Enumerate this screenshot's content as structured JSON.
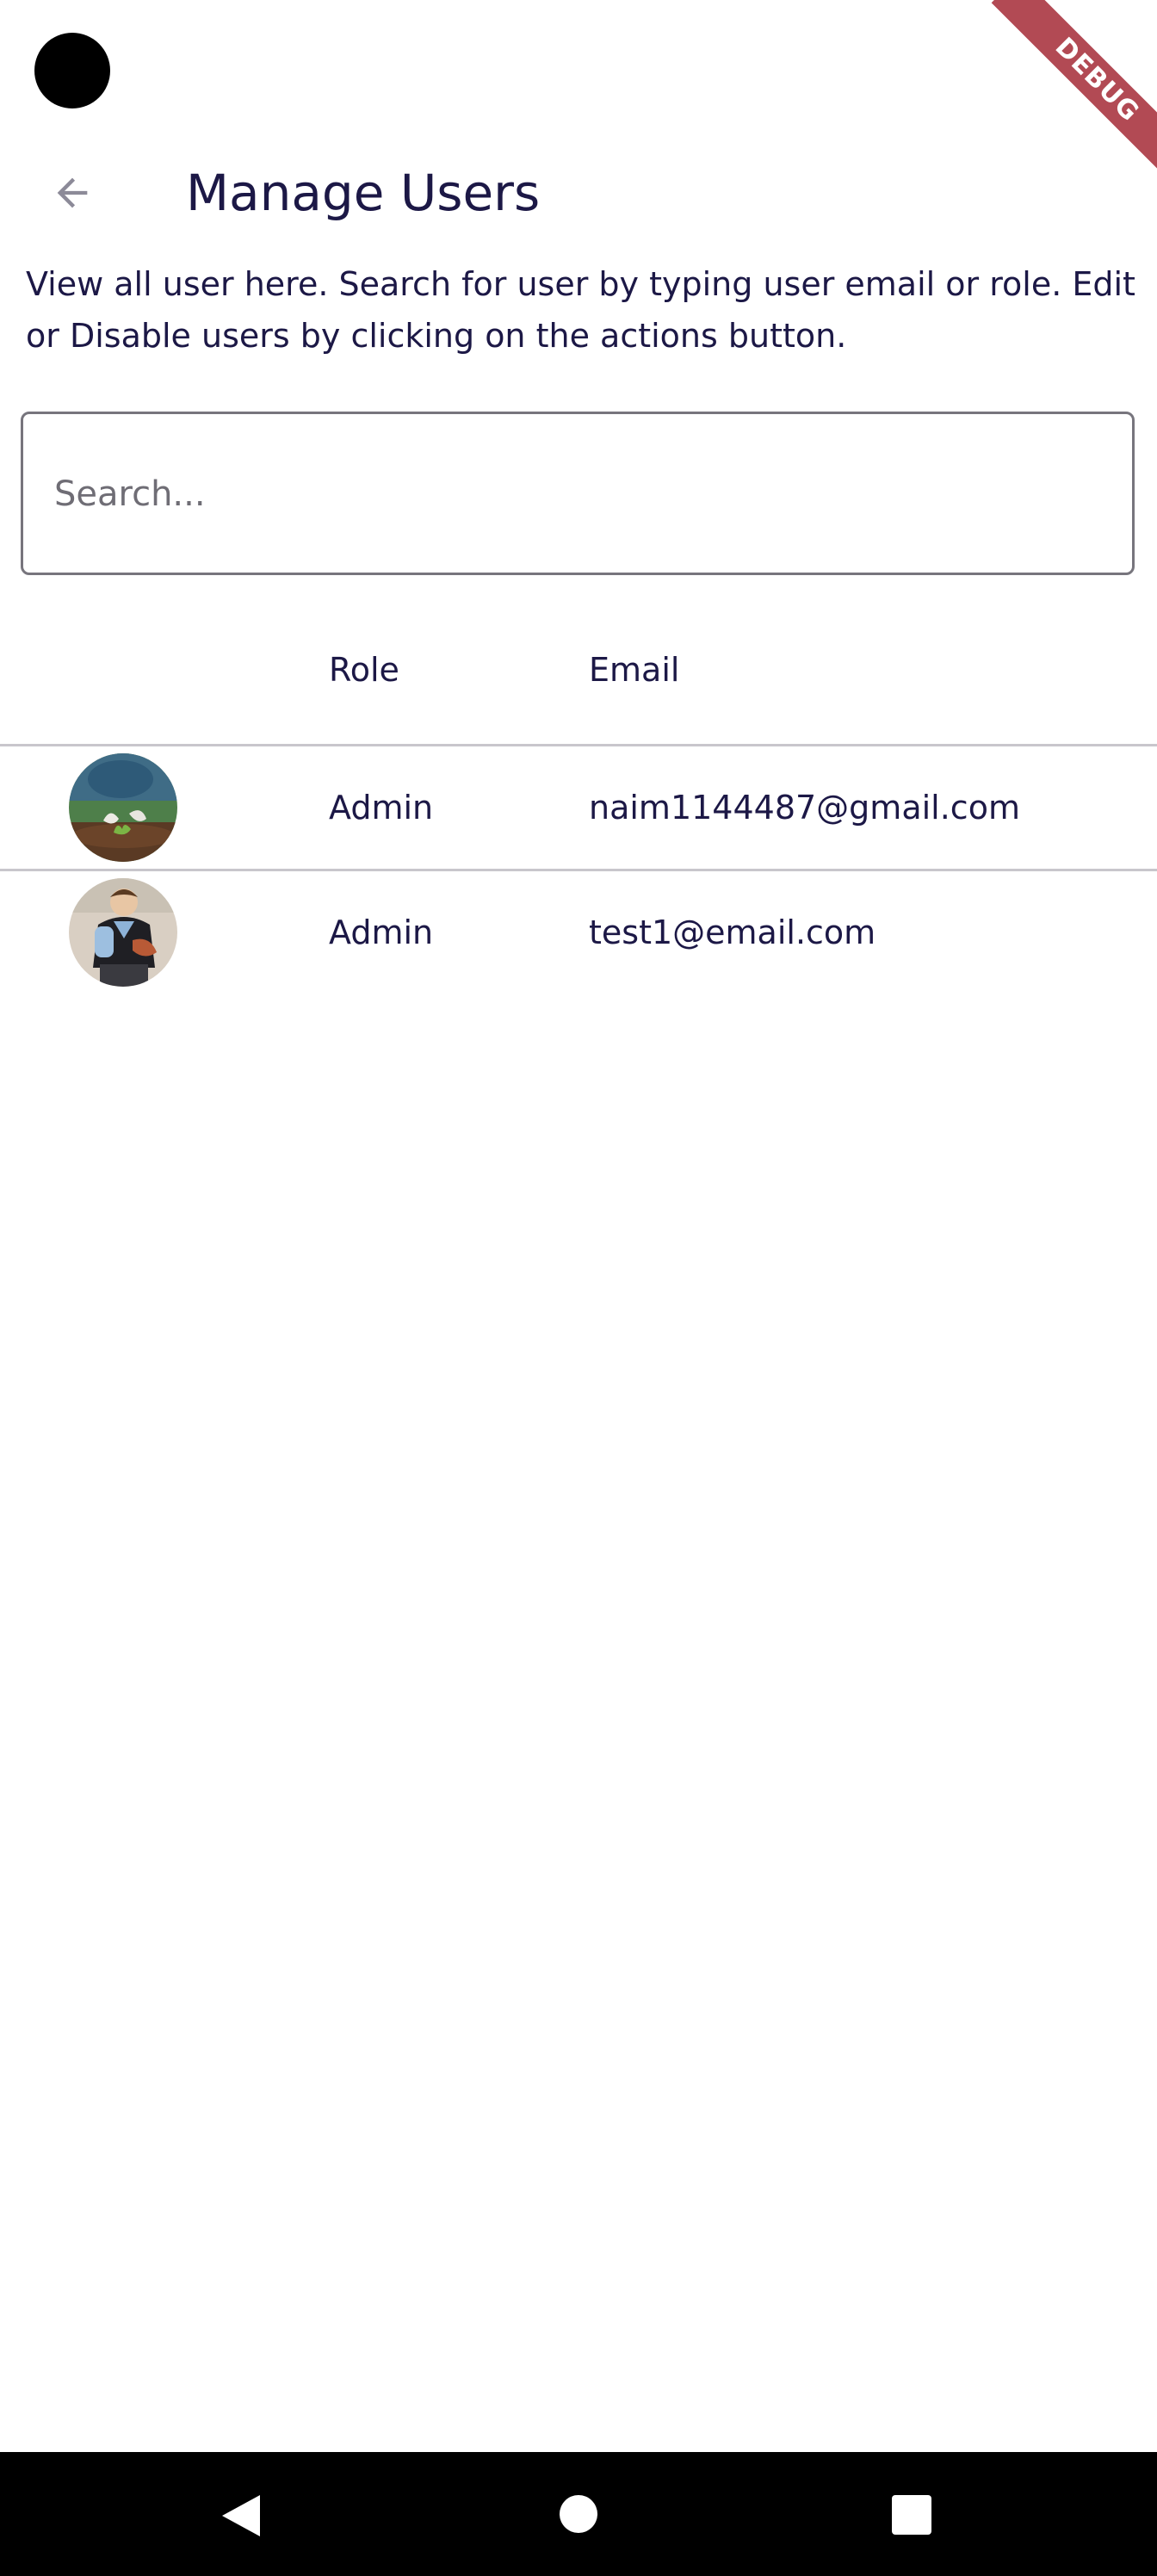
{
  "debug_banner": "DEBUG",
  "app_bar": {
    "title": "Manage Users",
    "back_icon": "arrow-left-icon"
  },
  "description": "View all user here. Search for user by typing user email or role. Edit or Disable users by clicking on the actions button.",
  "search": {
    "placeholder": "Search...",
    "value": ""
  },
  "table": {
    "headers": {
      "avatar": "",
      "role": "Role",
      "email": "Email"
    },
    "rows": [
      {
        "avatar": "avatar-gardener-image",
        "role": "Admin",
        "email": "naim1144487@gmail.com"
      },
      {
        "avatar": "avatar-child-image",
        "role": "Admin",
        "email": "test1@email.com"
      }
    ]
  },
  "nav_bar": {
    "back_icon": "triangle-back-icon",
    "home_icon": "circle-home-icon",
    "recents_icon": "square-recents-icon"
  },
  "colors": {
    "text": "#1c1846",
    "border": "#77757d",
    "divider": "#c8c6cc",
    "debug": "#b24a54",
    "nav_bar": "#000000"
  }
}
